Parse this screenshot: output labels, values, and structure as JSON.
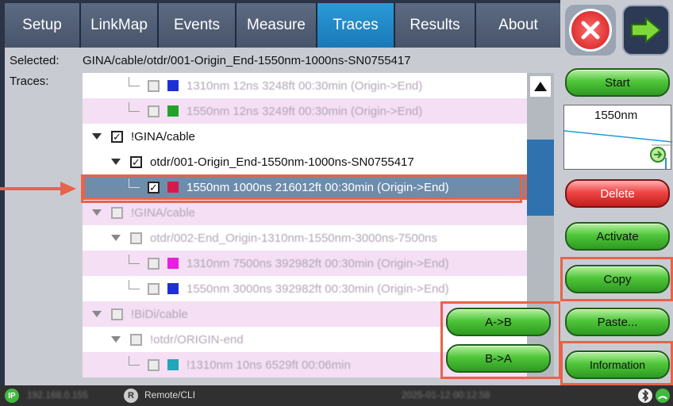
{
  "tabs": [
    {
      "label": "Setup",
      "active": false
    },
    {
      "label": "LinkMap",
      "active": false
    },
    {
      "label": "Events",
      "active": false
    },
    {
      "label": "Measure",
      "active": false
    },
    {
      "label": "Traces",
      "active": true
    },
    {
      "label": "Results",
      "active": false
    },
    {
      "label": "About",
      "active": false
    }
  ],
  "panel": {
    "selected_label": "Selected:",
    "selected_value": "GINA/cable/otdr/001-Origin_End-1550nm-1000ns-SN0755417",
    "traces_label": "Traces:"
  },
  "tree": [
    {
      "text": "1310nm 12ns 3248ft 00:30min (Origin->End)",
      "bg": "white",
      "checked": false,
      "swatch": "#1f2fd6",
      "faded": true
    },
    {
      "text": "1550nm 12ns 3249ft 00:30min (Origin->End)",
      "bg": "pink",
      "checked": false,
      "swatch": "#21a32b",
      "faded": true
    },
    {
      "text": "!GINA/cable",
      "bg": "white",
      "checked": true,
      "faded": false
    },
    {
      "text": "otdr/001-Origin_End-1550nm-1000ns-SN0755417",
      "bg": "white",
      "checked": true,
      "faded": false
    },
    {
      "text": "1550nm 1000ns 216012ft 00:30min (Origin->End)",
      "bg": "sel",
      "checked": true,
      "swatch": "#d61b4a",
      "faded": false
    },
    {
      "text": "!GINA/cable",
      "bg": "pink",
      "checked": false,
      "faded": true
    },
    {
      "text": "otdr/002-End_Origin-1310nm-1550nm-3000ns-7500ns",
      "bg": "white",
      "checked": false,
      "faded": true
    },
    {
      "text": "1310nm 7500ns 392982ft 00:30min (Origin->End)",
      "bg": "pink",
      "checked": false,
      "swatch": "#e81fe0",
      "faded": true
    },
    {
      "text": "1550nm 3000ns 392982ft 00:30min (Origin->End)",
      "bg": "white",
      "checked": false,
      "swatch": "#1f2fd6",
      "faded": true
    },
    {
      "text": "!BiDi/cable",
      "bg": "pink",
      "checked": false,
      "faded": true
    },
    {
      "text": "!otdr/ORIGIN-end",
      "bg": "white",
      "checked": false,
      "faded": true
    },
    {
      "text": "!1310nm 10ns 6529ft 00:06min",
      "bg": "pink",
      "checked": false,
      "swatch": "#1fa8b8",
      "faded": true
    }
  ],
  "buttons": {
    "a_to_b": "A->B",
    "b_to_a": "B->A",
    "start": "Start",
    "delete": "Delete",
    "activate": "Activate",
    "copy": "Copy",
    "paste": "Paste...",
    "information": "Information"
  },
  "preview": {
    "label": "1550nm"
  },
  "status": {
    "ip_badge": "IP",
    "ip_address": "192.168.0.155",
    "remote_badge": "R",
    "remote": "Remote/CLI",
    "datetime": "2025-01-12 00:12:58"
  },
  "colors": {
    "active_tab": "#1a78b8",
    "highlight": "#e8634a",
    "green_button": "#4fc63a",
    "red_button": "#f04545"
  }
}
